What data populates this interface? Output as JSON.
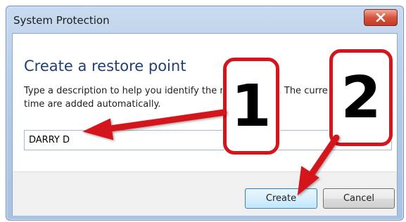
{
  "window": {
    "title": "System Protection",
    "close_icon": "close-icon"
  },
  "dialog": {
    "heading": "Create a restore point",
    "description": "Type a description to help you identify the restore point. The current date and time are added automatically.",
    "input_value": "DARRY D"
  },
  "buttons": {
    "create": "Create",
    "cancel": "Cancel"
  },
  "annotations": {
    "step1": "1",
    "step2": "2",
    "color": "#d4151b"
  }
}
